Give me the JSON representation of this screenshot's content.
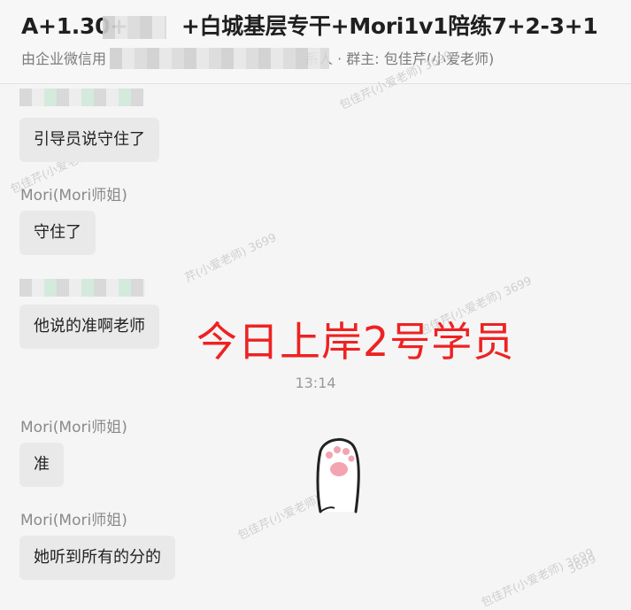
{
  "header": {
    "title_part1": "A+1.30+",
    "title_part2": "+白城基层专干+Mori1v1陪练7+2-3+1",
    "subtitle_prefix": "由企业微信用",
    "subtitle_suffix": "系人 · 群主: 包佳芹(小爱老师)"
  },
  "messages": [
    {
      "text": "引导员说守住了"
    },
    {
      "sender": "Mori(Mori师姐)",
      "text": "守住了"
    },
    {
      "text": "他说的准啊老师"
    },
    {
      "sender": "Mori(Mori师姐)",
      "text": "准"
    },
    {
      "sender": "Mori(Mori师姐)",
      "text": "她听到所有的分的"
    }
  ],
  "timestamp": "13:14",
  "overlay_text": "今日上岸2号学员",
  "watermarks": [
    "包佳芹(小爱老师) 3699",
    "包佳芹(小爱老师) 3699",
    "芹(小爱老师) 3699",
    "包佳芹(小爱老师) 3699",
    "包佳芹(小爱老师) 3699",
    "3699",
    "包佳芹(小爱老师) 3699"
  ],
  "sticker_icon": "cat-paw-sticker",
  "colors": {
    "overlay": "#ee2222",
    "bubble": "#e9e9e9",
    "sender": "#8a8a8a"
  }
}
